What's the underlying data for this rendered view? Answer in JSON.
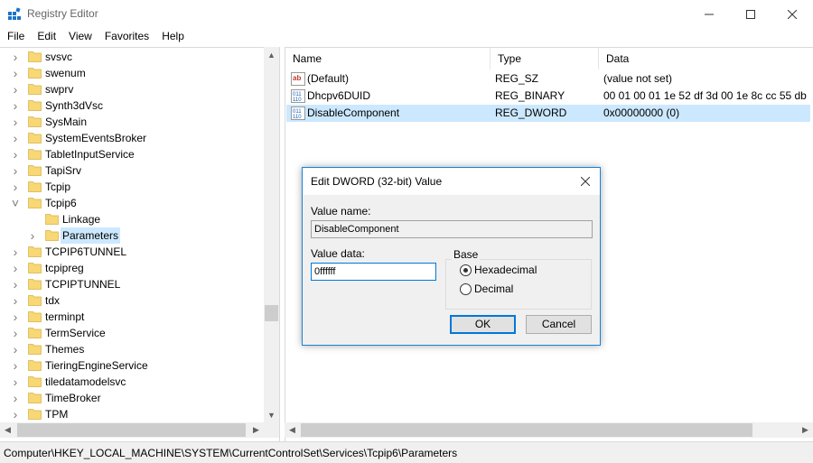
{
  "window": {
    "title": "Registry Editor"
  },
  "menu": [
    "File",
    "Edit",
    "View",
    "Favorites",
    "Help"
  ],
  "tree": {
    "items": [
      {
        "label": "svsvc",
        "expandable": true
      },
      {
        "label": "swenum",
        "expandable": true
      },
      {
        "label": "swprv",
        "expandable": true
      },
      {
        "label": "Synth3dVsc",
        "expandable": true
      },
      {
        "label": "SysMain",
        "expandable": true
      },
      {
        "label": "SystemEventsBroker",
        "expandable": true
      },
      {
        "label": "TabletInputService",
        "expandable": true
      },
      {
        "label": "TapiSrv",
        "expandable": true
      },
      {
        "label": "Tcpip",
        "expandable": true
      },
      {
        "label": "Tcpip6",
        "expandable": true,
        "expanded": true
      },
      {
        "label": "Linkage",
        "expandable": false,
        "child": true
      },
      {
        "label": "Parameters",
        "expandable": true,
        "child": true,
        "selected": true
      },
      {
        "label": "TCPIP6TUNNEL",
        "expandable": true
      },
      {
        "label": "tcpipreg",
        "expandable": true
      },
      {
        "label": "TCPIPTUNNEL",
        "expandable": true
      },
      {
        "label": "tdx",
        "expandable": true
      },
      {
        "label": "terminpt",
        "expandable": true
      },
      {
        "label": "TermService",
        "expandable": true
      },
      {
        "label": "Themes",
        "expandable": true
      },
      {
        "label": "TieringEngineService",
        "expandable": true
      },
      {
        "label": "tiledatamodelsvc",
        "expandable": true
      },
      {
        "label": "TimeBroker",
        "expandable": true
      },
      {
        "label": "TPM",
        "expandable": true
      }
    ]
  },
  "list": {
    "columns": {
      "name": "Name",
      "type": "Type",
      "data": "Data"
    },
    "rows": [
      {
        "icon": "string-value-icon",
        "name": "(Default)",
        "type": "REG_SZ",
        "data": "(value not set)"
      },
      {
        "icon": "binary-value-icon",
        "name": "Dhcpv6DUID",
        "type": "REG_BINARY",
        "data": "00 01 00 01 1e 52 df 3d 00 1e 8c cc 55 db"
      },
      {
        "icon": "binary-value-icon",
        "name": "DisableComponent",
        "type": "REG_DWORD",
        "data": "0x00000000 (0)",
        "selected": true
      }
    ]
  },
  "status": {
    "path": "Computer\\HKEY_LOCAL_MACHINE\\SYSTEM\\CurrentControlSet\\Services\\Tcpip6\\Parameters"
  },
  "dialog": {
    "title": "Edit DWORD (32-bit) Value",
    "value_name_label": "Value name:",
    "value_name": "DisableComponent",
    "value_data_label": "Value data:",
    "value_data": "0ffffff",
    "base_label": "Base",
    "base_options": [
      {
        "label": "Hexadecimal",
        "checked": true
      },
      {
        "label": "Decimal",
        "checked": false
      }
    ],
    "ok_label": "OK",
    "cancel_label": "Cancel"
  },
  "colors": {
    "selection": "#cce8ff",
    "dialog_border": "#1883d7",
    "folder": "#f8d775"
  }
}
